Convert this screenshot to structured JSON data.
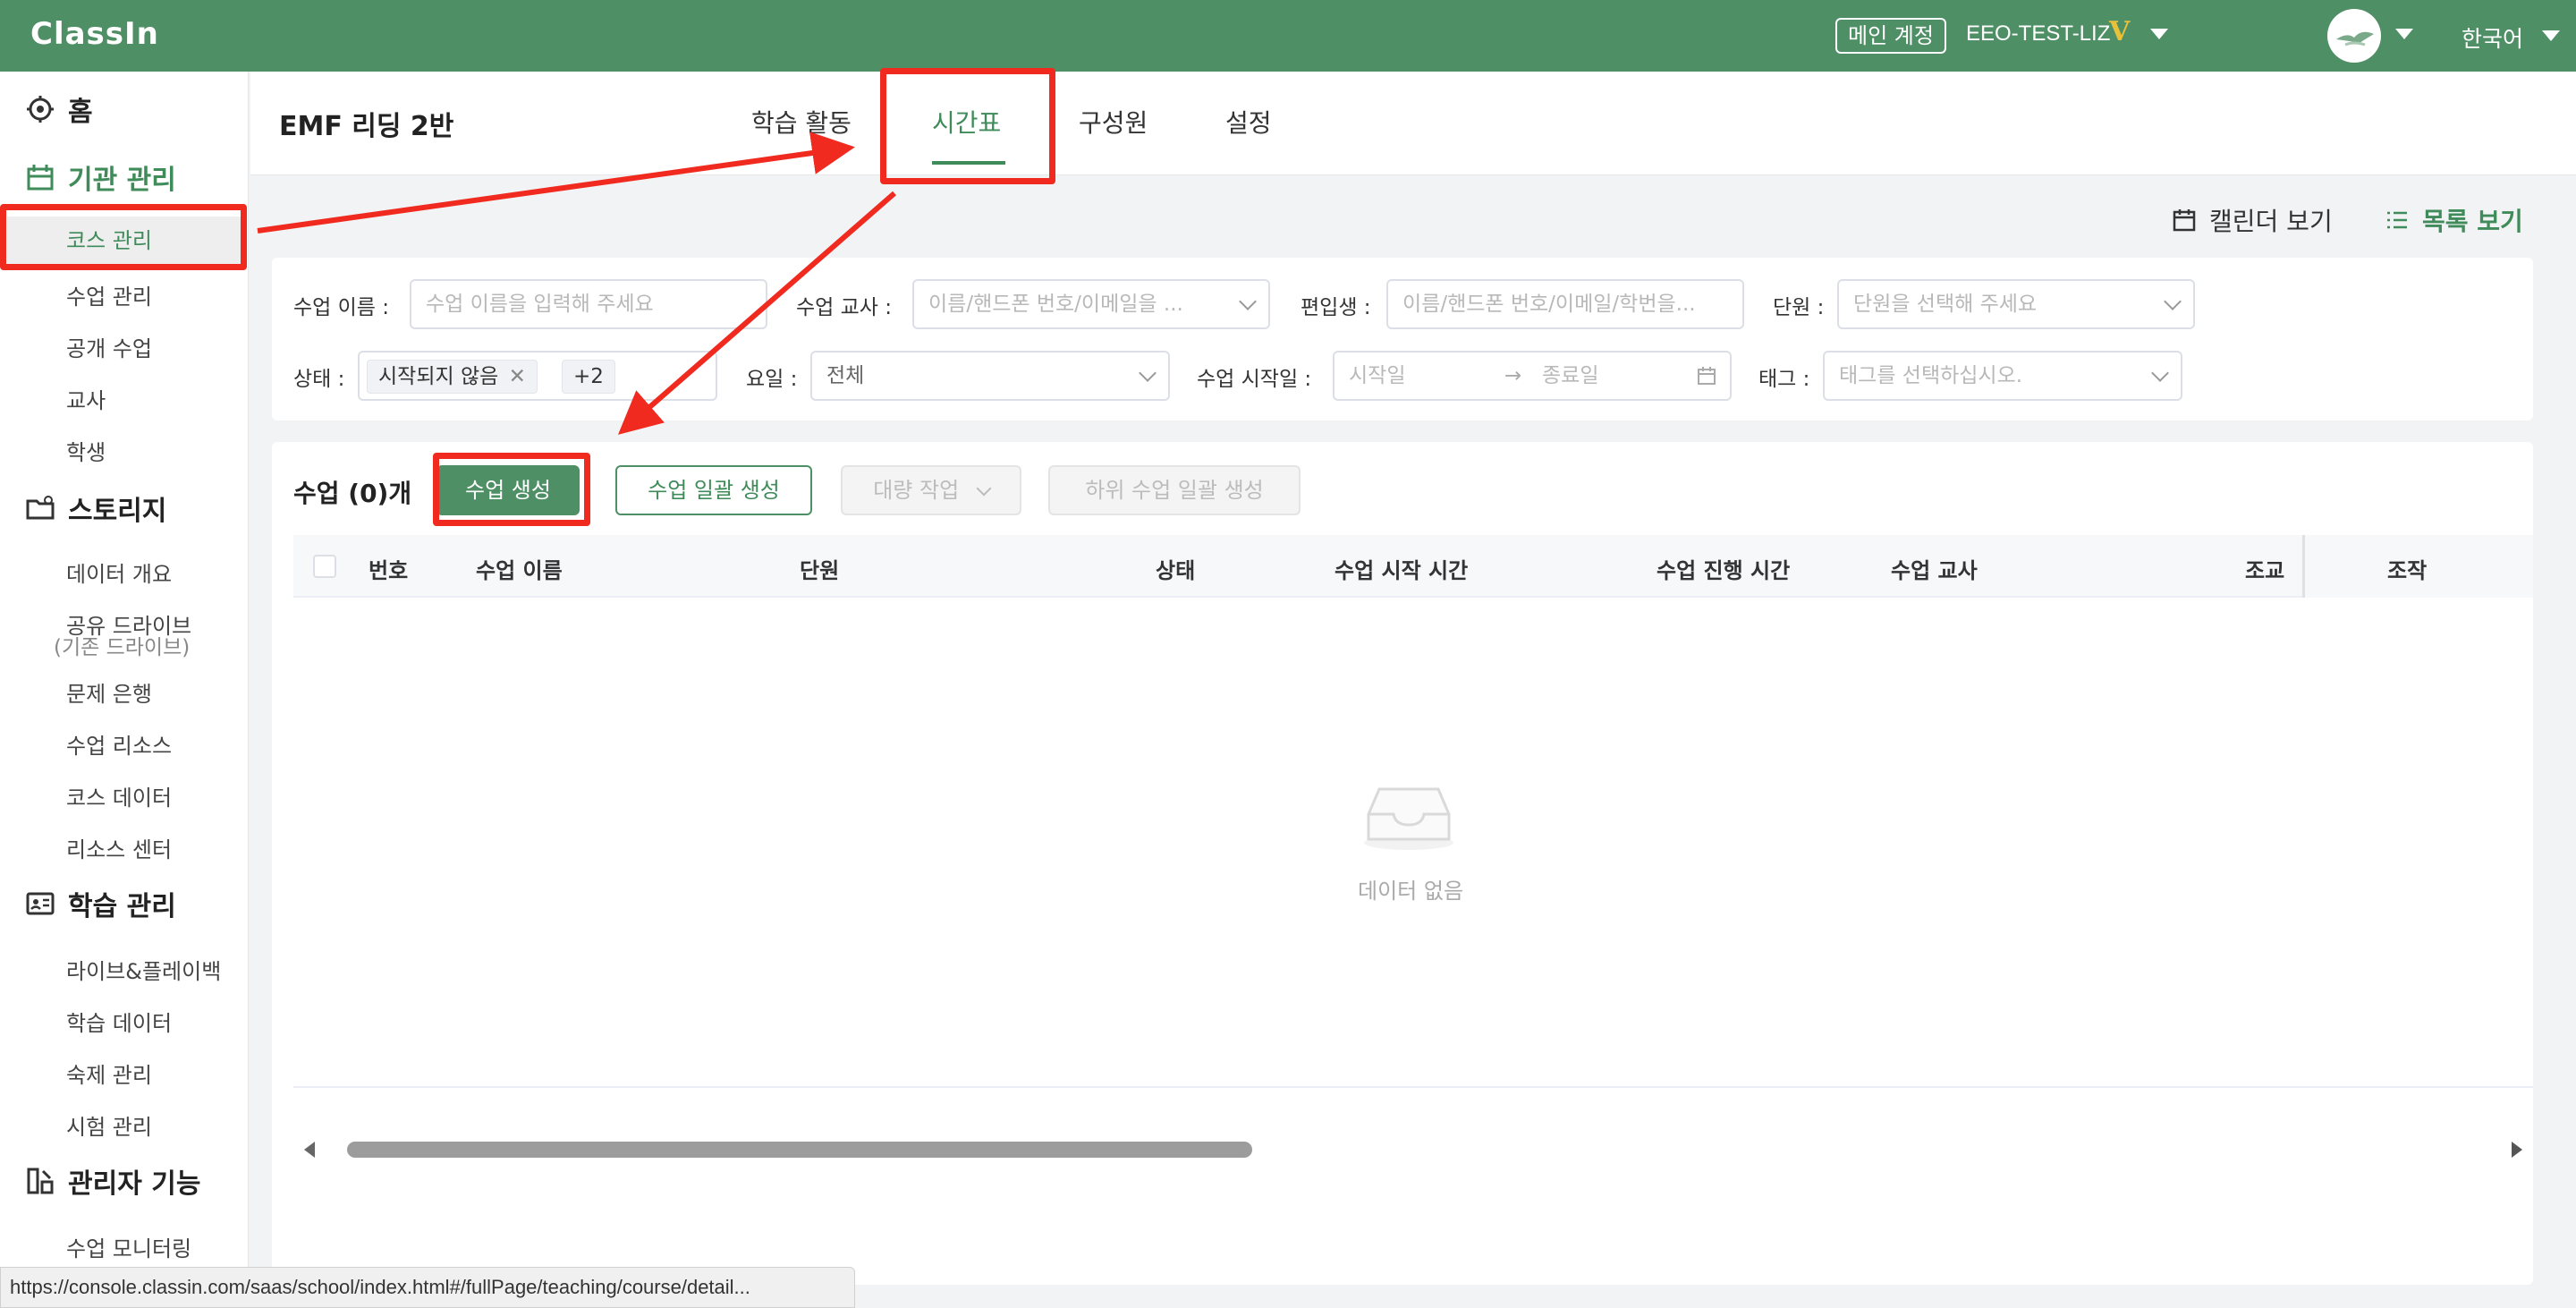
{
  "topbar": {
    "logo": "ClassIn",
    "main_account": "메인 계정",
    "account_name": "EEO-TEST-LIZ",
    "vip_badge": "V",
    "language": "한국어"
  },
  "sidebar": {
    "home": "홈",
    "org_section": "기관 관리",
    "org_items": [
      "코스 관리",
      "수업 관리",
      "공개 수업",
      "교사",
      "학생"
    ],
    "storage_section": "스토리지",
    "storage_items": [
      "데이터 개요",
      "공유 드라이브",
      "문제 은행",
      "수업 리소스",
      "코스 데이터",
      "리소스 센터"
    ],
    "storage_sub": "(기존 드라이브)",
    "learning_section": "학습 관리",
    "learning_items": [
      "라이브&플레이백",
      "학습 데이터",
      "숙제 관리",
      "시험 관리"
    ],
    "admin_section": "관리자 기능",
    "admin_items": [
      "수업 모니터링"
    ]
  },
  "course": {
    "title": "EMF 리딩 2반",
    "tabs": [
      "학습 활동",
      "시간표",
      "구성원",
      "설정"
    ],
    "active_tab": "시간표"
  },
  "views": {
    "calendar": "캘린더 보기",
    "list": "목록 보기"
  },
  "filters": {
    "lesson_name_label": "수업 이름 :",
    "lesson_name_placeholder": "수업 이름을 입력해 주세요",
    "teacher_label": "수업 교사 :",
    "teacher_placeholder": "이름/핸드폰 번호/이메일을 ...",
    "transfer_label": "편입생 :",
    "transfer_placeholder": "이름/핸드폰 번호/이메일/학번을...",
    "unit_label": "단원 :",
    "unit_placeholder": "단원을 선택해 주세요",
    "status_label": "상태 :",
    "status_chip": "시작되지 않음",
    "status_more": "+2",
    "weekday_label": "요일 :",
    "weekday_value": "전체",
    "start_date_label": "수업 시작일 :",
    "start_placeholder": "시작일",
    "range_arrow": "→",
    "end_placeholder": "종료일",
    "tag_label": "태그 :",
    "tag_placeholder": "태그를 선택하십시오."
  },
  "table": {
    "title": "수업 (0)개",
    "create_button": "수업 생성",
    "bulk_create_button": "수업 일괄 생성",
    "bulk_action_button": "대량 작업",
    "sub_bulk_button": "하위 수업 일괄 생성",
    "columns": [
      "번호",
      "수업 이름",
      "단원",
      "상태",
      "수업 시작 시간",
      "수업 진행 시간",
      "수업 교사",
      "조교",
      "조작"
    ],
    "empty_text": "데이터 없음"
  },
  "status_url": "https://console.classin.com/saas/school/index.html#/fullPage/teaching/course/detail...",
  "colors": {
    "brand_green": "#4f8f66",
    "annotation_red": "#f02a1f"
  }
}
